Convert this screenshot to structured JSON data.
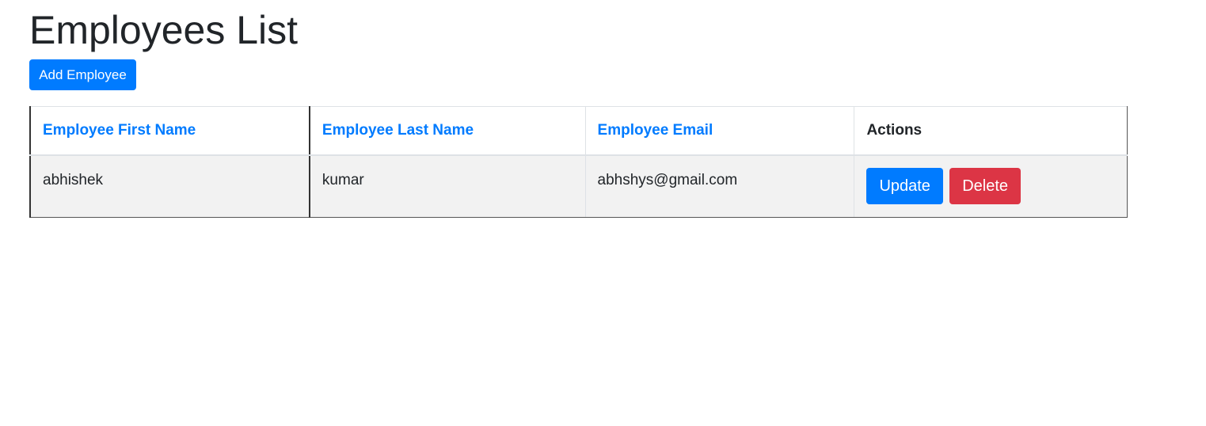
{
  "page": {
    "title": "Employees List",
    "add_button_label": "Add Employee"
  },
  "table": {
    "headers": {
      "first_name": "Employee First Name",
      "last_name": "Employee Last Name",
      "email": "Employee Email",
      "actions": "Actions"
    },
    "rows": [
      {
        "first_name": "abhishek",
        "last_name": "kumar",
        "email": "abhshys@gmail.com",
        "update_label": "Update",
        "delete_label": "Delete"
      }
    ]
  },
  "colors": {
    "primary": "#007bff",
    "danger": "#dc3545",
    "row_background": "#f2f2f2",
    "text": "#212529"
  }
}
